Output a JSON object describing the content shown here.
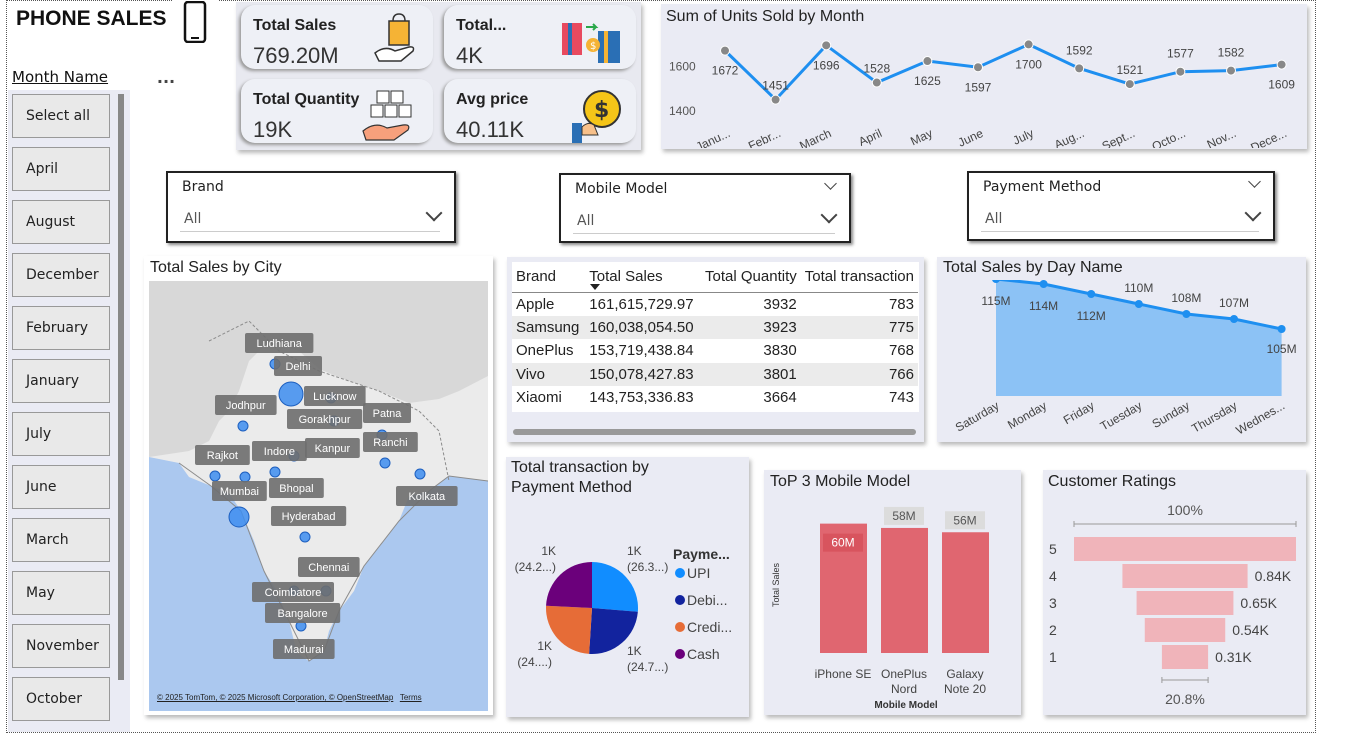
{
  "header": {
    "title": "PHONE SALES"
  },
  "kpis": [
    {
      "label": "Total Sales",
      "value": "769.20M",
      "icon": "shopping-bag-hand-icon"
    },
    {
      "label": "Total...",
      "value": "4K",
      "icon": "cards-exchange-icon"
    },
    {
      "label": "Total Quantity",
      "value": "19K",
      "icon": "boxes-hand-icon"
    },
    {
      "label": "Avg price",
      "value": "40.11K",
      "icon": "dollar-coin-hand-icon"
    }
  ],
  "month_slicer": {
    "title": "Month Name",
    "more": "...",
    "items": [
      "Select all",
      "April",
      "August",
      "December",
      "February",
      "January",
      "July",
      "June",
      "March",
      "May",
      "November",
      "October"
    ]
  },
  "filters": {
    "brand": {
      "label": "Brand",
      "value": "All"
    },
    "model": {
      "label": "Mobile Model",
      "value": "All"
    },
    "payment": {
      "label": "Payment Method",
      "value": "All"
    }
  },
  "units_chart": {
    "title": "Sum of Units Sold by Month",
    "y_ticks": [
      "1600",
      "1400"
    ],
    "color": "#1e8ff0"
  },
  "map": {
    "title": "Total Sales by City",
    "cities": [
      "Ludhiana",
      "Delhi",
      "Lucknow",
      "Jodhpur",
      "Gorakhpur",
      "Patna",
      "Kanpur",
      "Ranchi",
      "Rajkot",
      "Indore",
      "Mumbai",
      "Bhopal",
      "Kolkata",
      "Hyderabad",
      "Chennai",
      "Coimbatore",
      "Bangalore",
      "Madurai"
    ],
    "attribution": "© 2025 TomTom, © 2025 Microsoft Corporation, © OpenStreetMap",
    "terms": "Terms"
  },
  "brand_table": {
    "headers": [
      "Brand",
      "Total Sales",
      "Total Quantity",
      "Total transaction"
    ],
    "rows": [
      [
        "Apple",
        "161,615,729.97",
        "3932",
        "783"
      ],
      [
        "Samsung",
        "160,038,054.50",
        "3923",
        "775"
      ],
      [
        "OnePlus",
        "153,719,438.84",
        "3830",
        "768"
      ],
      [
        "Vivo",
        "150,078,427.83",
        "3801",
        "766"
      ],
      [
        "Xiaomi",
        "143,753,336.83",
        "3664",
        "743"
      ]
    ]
  },
  "day_chart": {
    "title": "Total Sales by Day Name",
    "color": "#1e8ff0",
    "fill": "#8cc2f5"
  },
  "payment_chart": {
    "title_line1": "Total transaction by",
    "title_line2": "Payment Method",
    "legend_title": "Payme...",
    "slice_labels": [
      {
        "top": "1K",
        "bottom": "(26.3...)"
      },
      {
        "top": "1K",
        "bottom": "(24.7...)"
      },
      {
        "top": "1K",
        "bottom": "(24....)"
      },
      {
        "top": "1K",
        "bottom": "(24.2...)"
      }
    ]
  },
  "top3_chart": {
    "title": "ToP 3 Mobile Model",
    "xlabel": "Mobile Model",
    "ylabel": "Total Sales",
    "color": "#e06670"
  },
  "ratings_chart": {
    "title": "Customer Ratings",
    "top_pct": "100%",
    "bottom_pct": "20.8%",
    "color": "#f0b4ba"
  },
  "chart_data": [
    {
      "type": "line",
      "title": "Sum of Units Sold by Month",
      "categories": [
        "Janu...",
        "Febr...",
        "March",
        "April",
        "May",
        "June",
        "July",
        "Aug...",
        "Sept...",
        "Octo...",
        "Nov...",
        "Dece..."
      ],
      "values": [
        1672,
        1451,
        1696,
        1528,
        1625,
        1597,
        1700,
        1592,
        1521,
        1577,
        1582,
        1609
      ],
      "ylim": [
        1350,
        1720
      ]
    },
    {
      "type": "area",
      "title": "Total Sales by Day Name",
      "categories": [
        "Saturday",
        "Monday",
        "Friday",
        "Tuesday",
        "Sunday",
        "Thursday",
        "Wednes..."
      ],
      "values": [
        115,
        114,
        112,
        110,
        108,
        107,
        105
      ],
      "labels": [
        "115M",
        "114M",
        "112M",
        "110M",
        "108M",
        "107M",
        "105M"
      ],
      "ylim": [
        100,
        116
      ]
    },
    {
      "type": "pie",
      "title": "Total transaction by Payment Method",
      "categories": [
        "UPI",
        "Debi...",
        "Credi...",
        "Cash"
      ],
      "values": [
        26.3,
        24.7,
        24.8,
        24.2
      ],
      "colors": [
        "#118dff",
        "#12239e",
        "#e66c37",
        "#6b007b"
      ]
    },
    {
      "type": "bar",
      "title": "ToP 3 Mobile Model",
      "categories": [
        "iPhone SE",
        "OnePlus Nord",
        "Galaxy Note 20"
      ],
      "categories_display": [
        [
          "iPhone SE"
        ],
        [
          "OnePlus",
          "Nord"
        ],
        [
          "Galaxy",
          "Note 20"
        ]
      ],
      "values": [
        60,
        58,
        56
      ],
      "labels": [
        "60M",
        "58M",
        "56M"
      ],
      "ylim": [
        0,
        64
      ]
    },
    {
      "type": "bar",
      "title": "Customer Ratings",
      "categories": [
        "5",
        "4",
        "3",
        "2",
        "1"
      ],
      "values": [
        1.49,
        0.84,
        0.65,
        0.54,
        0.31
      ],
      "labels": [
        "",
        "0.84K",
        "0.65K",
        "0.54K",
        "0.31K"
      ]
    }
  ]
}
